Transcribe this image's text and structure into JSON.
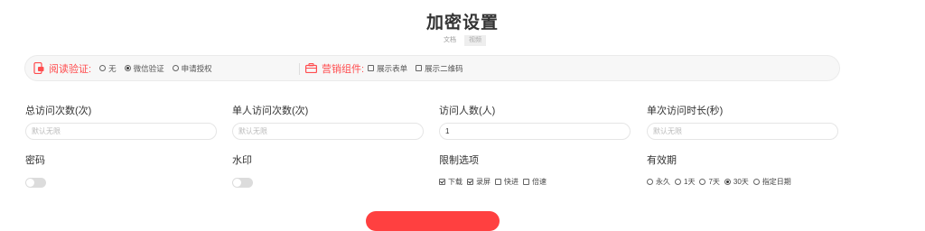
{
  "header": {
    "title": "加密设置",
    "tabs": [
      {
        "label": "文档",
        "active": false
      },
      {
        "label": "视频",
        "active": true
      }
    ]
  },
  "settings_bar": {
    "read_verify": {
      "label": "阅读验证:",
      "icon": "phone-lock-icon",
      "options": [
        {
          "label": "无",
          "selected": false
        },
        {
          "label": "微信验证",
          "selected": true
        },
        {
          "label": "申请授权",
          "selected": false
        }
      ]
    },
    "marketing": {
      "label": "营销组件:",
      "icon": "briefcase-icon",
      "options": [
        {
          "label": "展示表单",
          "checked": false
        },
        {
          "label": "展示二维码",
          "checked": false
        }
      ]
    }
  },
  "fields": {
    "total_visits": {
      "label": "总访问次数(次)",
      "placeholder": "默认无限",
      "value": ""
    },
    "single_visits": {
      "label": "单人访问次数(次)",
      "placeholder": "默认无限",
      "value": ""
    },
    "visitors": {
      "label": "访问人数(人)",
      "placeholder": "",
      "value": "1"
    },
    "single_duration": {
      "label": "单次访问时长(秒)",
      "placeholder": "默认无限",
      "value": ""
    }
  },
  "password": {
    "label": "密码",
    "enabled": false
  },
  "watermark": {
    "label": "水印",
    "enabled": false
  },
  "restrictions": {
    "label": "限制选项",
    "options": [
      {
        "label": "下载",
        "checked": true
      },
      {
        "label": "录屏",
        "checked": true
      },
      {
        "label": "快进",
        "checked": false
      },
      {
        "label": "倍速",
        "checked": false
      }
    ]
  },
  "validity": {
    "label": "有效期",
    "options": [
      {
        "label": "永久",
        "selected": false
      },
      {
        "label": "1天",
        "selected": false
      },
      {
        "label": "7天",
        "selected": false
      },
      {
        "label": "30天",
        "selected": true
      },
      {
        "label": "指定日期",
        "selected": false
      }
    ]
  },
  "colors": {
    "accent": "#ff4d4f",
    "button": "#ff4040",
    "toggle_off": "#dcdcdc"
  }
}
